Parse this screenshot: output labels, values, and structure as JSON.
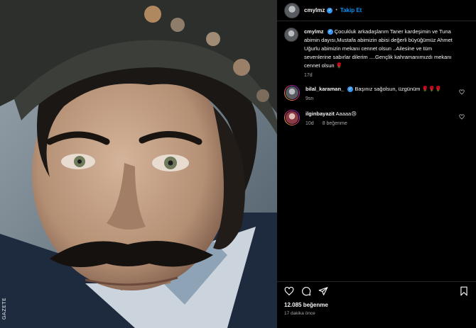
{
  "post": {
    "username": "cmylmz",
    "follow_label": "Takip Et",
    "photo_watermark": "GAZETE"
  },
  "caption": {
    "username": "cmylmz",
    "text": "Çocukluk arkadaşlarım Taner kardeşimin ve Tuna abimin dayısı,Mustafa abimizin abisi değerli büyüğümüz Ahmet Uğurlu abimizin mekanı cennet olsun ..Ailesine ve tüm sevenlerine sabırlar dilerim ....Gençlik kahramanımızdı mekanı cennet olsun 🌹",
    "time": "17d"
  },
  "comments": [
    {
      "username": "bilal_karaman_",
      "text": "Başınız sağolsun, üzgünüm 🌹🌹🌹",
      "time": "9sn",
      "likes": ""
    },
    {
      "username": "ilginbayazit",
      "text": "Aaaaa😢",
      "time": "10d",
      "likes": "8 beğenme"
    }
  ],
  "footer": {
    "likes": "12.085 beğenme",
    "ago": "17 dakika önce"
  },
  "colors": {
    "accent": "#0095f6",
    "verified": "#3897f0",
    "background": "#000000"
  },
  "icons": [
    "heart-icon",
    "comment-icon",
    "share-icon",
    "bookmark-icon",
    "verified-icon"
  ]
}
